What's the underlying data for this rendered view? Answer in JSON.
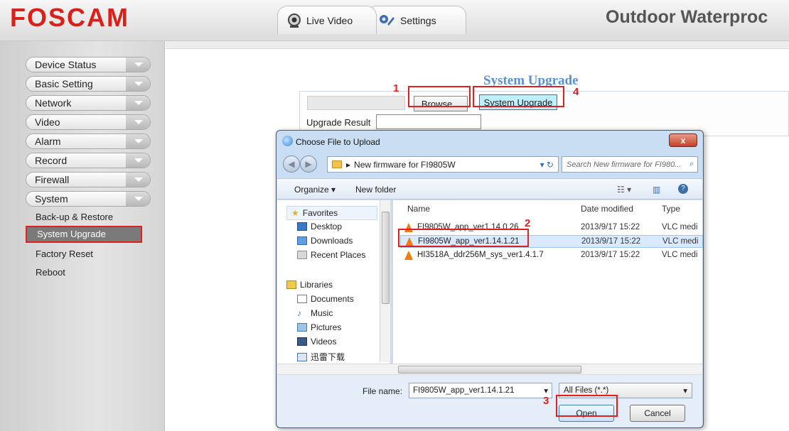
{
  "header": {
    "logo": "FOSCAM",
    "tabs": [
      {
        "label": "Live Video",
        "icon": "camera-icon"
      },
      {
        "label": "Settings",
        "icon": "gears-icon"
      }
    ],
    "title": "Outdoor Waterproc"
  },
  "sidebar": {
    "menus": [
      "Device Status",
      "Basic Setting",
      "Network",
      "Video",
      "Alarm",
      "Record",
      "Firewall",
      "System"
    ],
    "sub_items": [
      "Back-up & Restore",
      "System Upgrade",
      "Factory Reset",
      "Reboot"
    ],
    "selected": "System Upgrade"
  },
  "main": {
    "page_title": "System Upgrade",
    "browse_label": "Browse...",
    "upgrade_label": "System Upgrade",
    "result_label": "Upgrade Result"
  },
  "annotations": [
    "1",
    "2",
    "3",
    "4"
  ],
  "dialog": {
    "title": "Choose File to Upload",
    "close": "x",
    "path": "New firmware for FI9805W",
    "search_placeholder": "Search New firmware for FI980...",
    "toolbar": {
      "organize": "Organize ▾",
      "new_folder": "New folder"
    },
    "nav": {
      "favorites_header": "Favorites",
      "favorites": [
        "Desktop",
        "Downloads",
        "Recent Places"
      ],
      "libraries_header": "Libraries",
      "libraries": [
        "Documents",
        "Music",
        "Pictures",
        "Videos",
        "迅雷下载"
      ]
    },
    "columns": {
      "name": "Name",
      "date": "Date modified",
      "type": "Type"
    },
    "files": [
      {
        "name": "FI9805W_app_ver1.14.0.26",
        "date": "2013/9/17 15:22",
        "type": "VLC medi"
      },
      {
        "name": "FI9805W_app_ver1.14.1.21",
        "date": "2013/9/17 15:22",
        "type": "VLC medi"
      },
      {
        "name": "HI3518A_ddr256M_sys_ver1.4.1.7",
        "date": "2013/9/17 15:22",
        "type": "VLC medi"
      }
    ],
    "selected_file": "FI9805W_app_ver1.14.1.21",
    "file_name_label": "File name:",
    "file_name_value": "FI9805W_app_ver1.14.1.21",
    "file_type": "All Files (*.*)",
    "open_label": "Open",
    "cancel_label": "Cancel"
  }
}
